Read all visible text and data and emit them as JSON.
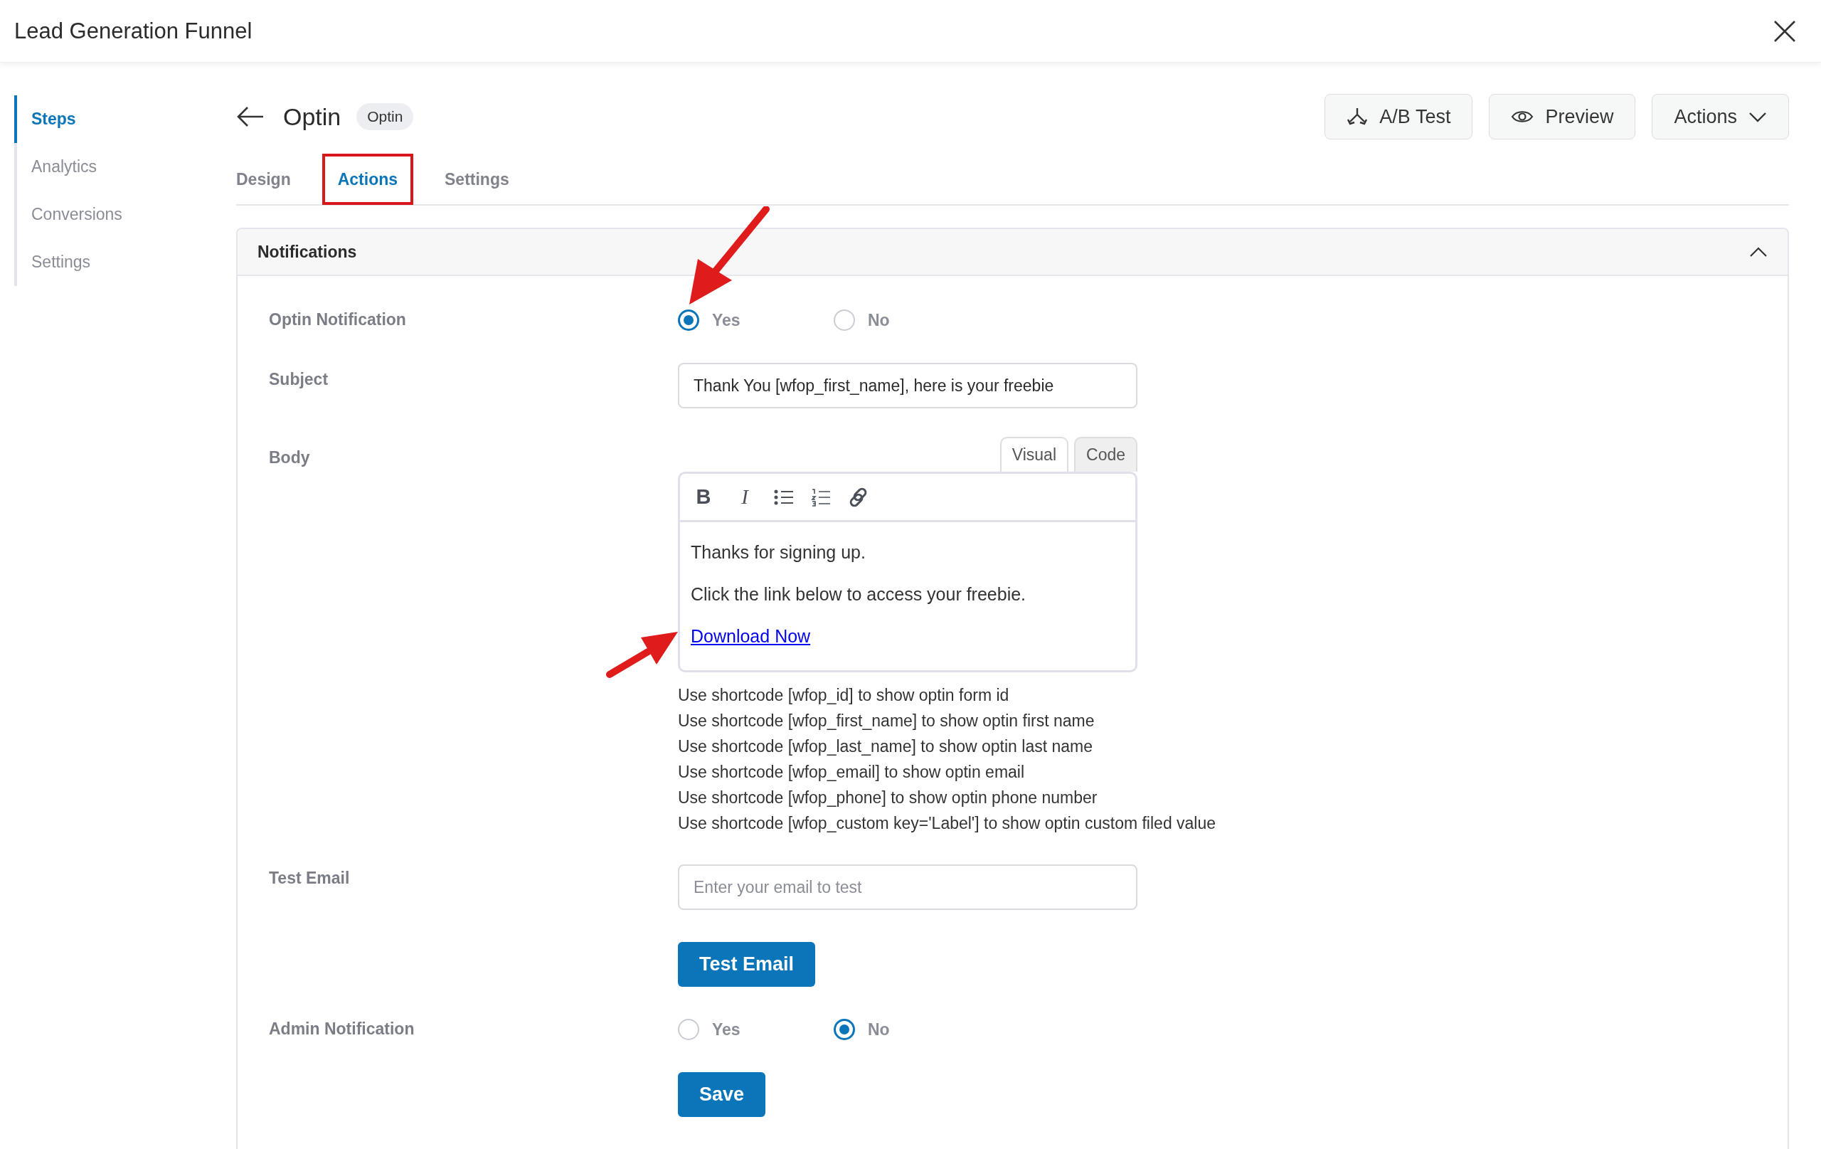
{
  "window": {
    "title": "Lead Generation Funnel"
  },
  "sidebar": {
    "items": [
      {
        "label": "Steps",
        "selected": true
      },
      {
        "label": "Analytics",
        "selected": false
      },
      {
        "label": "Conversions",
        "selected": false
      },
      {
        "label": "Settings",
        "selected": false
      }
    ]
  },
  "page": {
    "title": "Optin",
    "badge": "Optin",
    "buttons": [
      {
        "label": "A/B Test",
        "kind": "split"
      },
      {
        "label": "Preview",
        "kind": "eye"
      },
      {
        "label": "Actions",
        "kind": "dropdown"
      }
    ]
  },
  "tabs": [
    {
      "label": "Design",
      "selected": false,
      "highlighted": false
    },
    {
      "label": "Actions",
      "selected": true,
      "highlighted": true
    },
    {
      "label": "Settings",
      "selected": false,
      "highlighted": false
    }
  ],
  "panel": {
    "title": "Notifications",
    "expanded": true,
    "optin_notification": {
      "label": "Optin Notification",
      "options": [
        {
          "label": "Yes",
          "selected": true,
          "pointer_arrow": true
        },
        {
          "label": "No",
          "selected": false,
          "pointer_arrow": false
        }
      ]
    },
    "subject": {
      "label": "Subject",
      "value": "Thank You [wfop_first_name], here is your freebie"
    },
    "body": {
      "label": "Body",
      "modes": [
        {
          "label": "Visual",
          "selected": true
        },
        {
          "label": "Code",
          "selected": false
        }
      ],
      "toolbar": [
        {
          "kind": "bold",
          "glyph": "B"
        },
        {
          "kind": "italic",
          "glyph": "I"
        },
        {
          "kind": "bullets"
        },
        {
          "kind": "numbers"
        },
        {
          "kind": "link"
        }
      ],
      "paragraphs": [
        {
          "kind": "text",
          "text": "Thanks for signing up.",
          "pointer_arrow": false
        },
        {
          "kind": "text",
          "text": "Click the link below to access your freebie.",
          "pointer_arrow": false
        },
        {
          "kind": "link",
          "text": "Download Now",
          "pointer_arrow": true
        }
      ],
      "hints": [
        "Use shortcode [wfop_id] to show optin form id",
        "Use shortcode [wfop_first_name] to show optin first name",
        "Use shortcode [wfop_last_name] to show optin last name",
        "Use shortcode [wfop_email] to show optin email",
        "Use shortcode [wfop_phone] to show optin phone number",
        "Use shortcode [wfop_custom key='Label'] to show optin custom filed value"
      ]
    },
    "test_email": {
      "label": "Test Email",
      "placeholder": "Enter your email to test",
      "button": "Test Email"
    },
    "admin_notification": {
      "label": "Admin Notification",
      "options": [
        {
          "label": "Yes",
          "selected": false,
          "pointer_arrow": false
        },
        {
          "label": "No",
          "selected": true,
          "pointer_arrow": false
        }
      ]
    },
    "save_button": "Save"
  }
}
